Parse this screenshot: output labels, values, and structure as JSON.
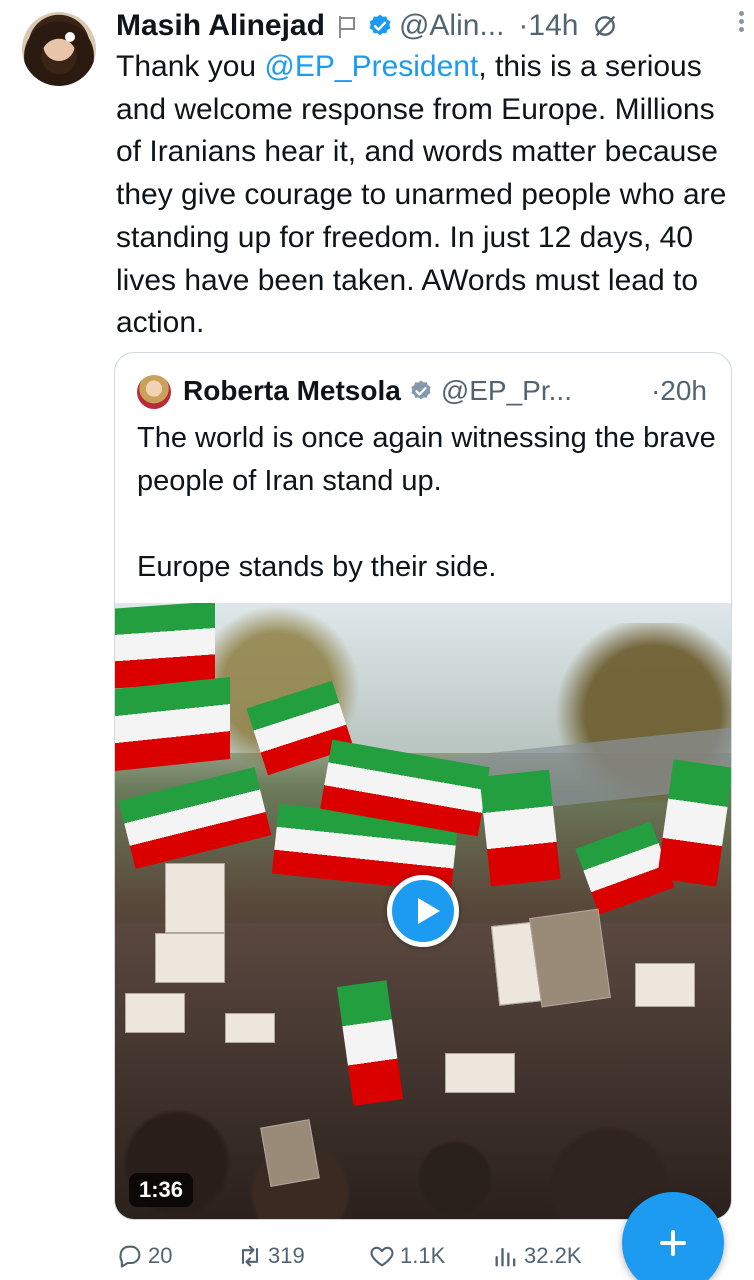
{
  "tweet": {
    "author_name": "Masih Alinejad",
    "handle": "@Alin...",
    "time": "·14h",
    "text_before_mention": "Thank you ",
    "mention": "@EP_President",
    "text_after_mention": ", this is a serious and welcome response from Europe. Millions of Iranians hear it, and words matter because they give courage to unarmed people who are standing up for freedom. In just 12 days, 40 lives have been taken. AWords must lead to action."
  },
  "quote": {
    "author_name": "Roberta Metsola",
    "handle": "@EP_Pr...",
    "time": "·20h",
    "text": "The world is once again witnessing the brave people of Iran stand up.\n\nEurope stands by their side.",
    "video_duration": "1:36"
  },
  "actions": {
    "replies": "20",
    "retweets": "319",
    "likes": "1.1K",
    "views": "32.2K"
  },
  "colors": {
    "accent": "#1d9bf0",
    "muted": "#536471",
    "text": "#0f1419"
  },
  "icons": {
    "verified": "verified-badge-icon",
    "flag": "flag-icon",
    "no_notify": "circle-slash-icon",
    "more": "more-vertical-icon",
    "reply": "reply-icon",
    "retweet": "retweet-icon",
    "like": "heart-icon",
    "views": "views-icon",
    "fab": "plus-icon",
    "play": "play-icon"
  }
}
